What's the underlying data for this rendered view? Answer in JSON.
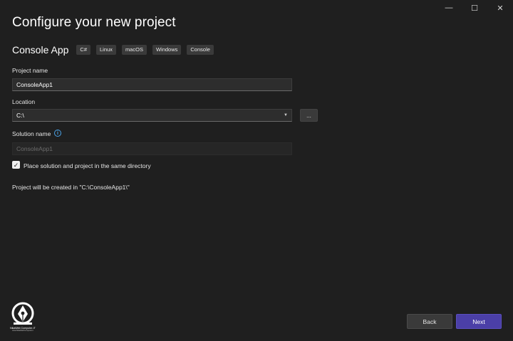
{
  "window_controls": {
    "minimize": "—",
    "maximize": "☐",
    "close": "✕"
  },
  "title": "Configure your new project",
  "template": {
    "name": "Console App",
    "tags": [
      "C#",
      "Linux",
      "macOS",
      "Windows",
      "Console"
    ]
  },
  "project_name": {
    "label": "Project name",
    "value": "ConsoleApp1"
  },
  "location": {
    "label": "Location",
    "value": "C:\\",
    "browse_label": "..."
  },
  "solution_name": {
    "label": "Solution name",
    "placeholder": "ConsoleApp1",
    "info_glyph": "i"
  },
  "same_directory": {
    "label": "Place solution and project in the same directory",
    "checked": true,
    "check_glyph": "✓"
  },
  "created_path": "Project will be created in \"C:\\ConsoleApp1\\\"",
  "watermark": {
    "name": "NikaWeb Computer-IT",
    "url": "www.NikaWebComputer.ir"
  },
  "buttons": {
    "back": "Back",
    "next": "Next"
  },
  "colors": {
    "background": "#1f1f1f",
    "accent": "#4b3fa7",
    "info": "#4aa3e8"
  }
}
